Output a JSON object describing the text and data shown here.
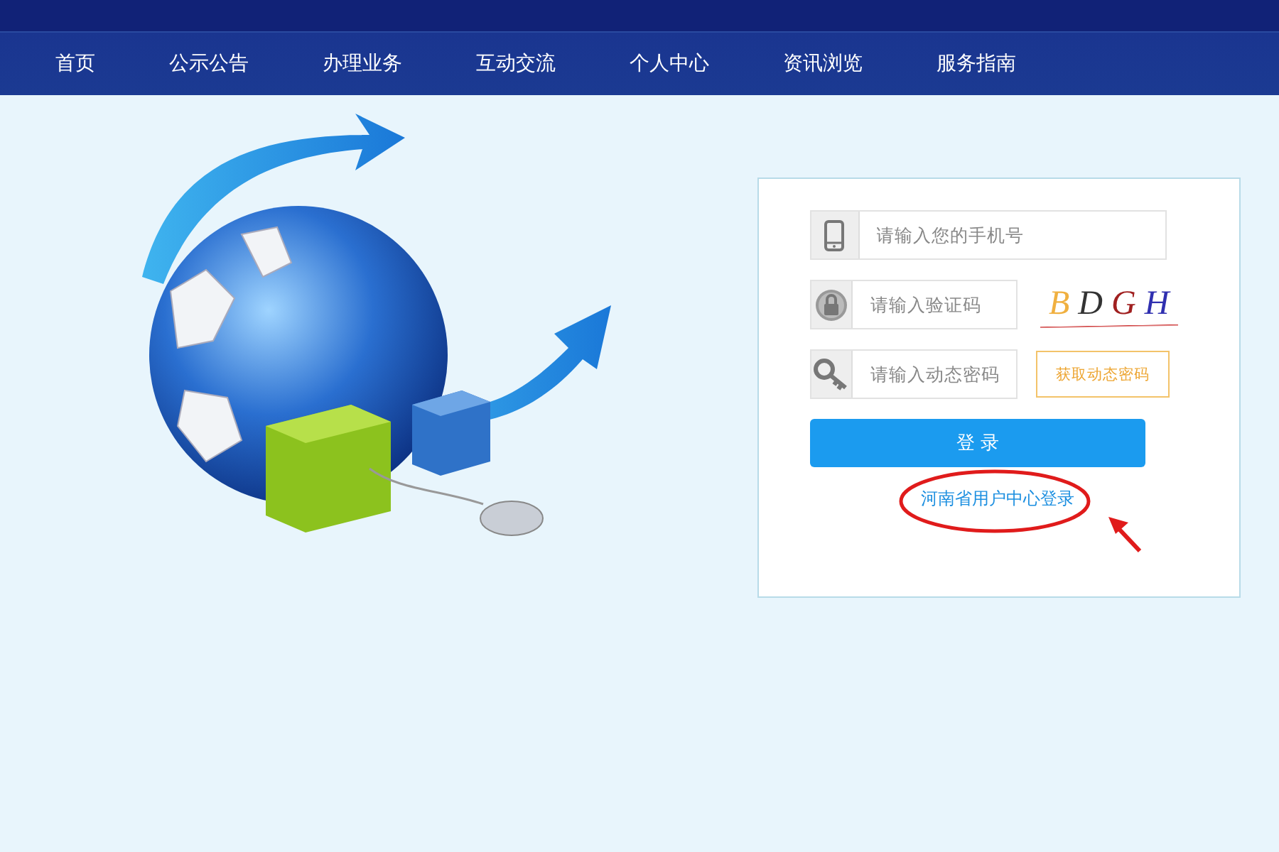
{
  "nav": {
    "items": [
      "首页",
      "公示公告",
      "办理业务",
      "互动交流",
      "个人中心",
      "资讯浏览",
      "服务指南"
    ]
  },
  "login": {
    "fields": [
      {
        "kind": "phone",
        "placeholder": "请输入您的手机号"
      },
      {
        "kind": "captcha",
        "placeholder": "请输入验证码"
      },
      {
        "kind": "sms",
        "placeholder": "请输入动态密码",
        "button": "获取动态密码"
      }
    ],
    "captcha": [
      {
        "char": "B",
        "color": "#f0b040"
      },
      {
        "char": "D",
        "color": "#333333"
      },
      {
        "char": "G",
        "color": "#a02020"
      },
      {
        "char": "H",
        "color": "#3030b0"
      }
    ],
    "submit": "登 录",
    "link": "河南省用户中心登录"
  }
}
